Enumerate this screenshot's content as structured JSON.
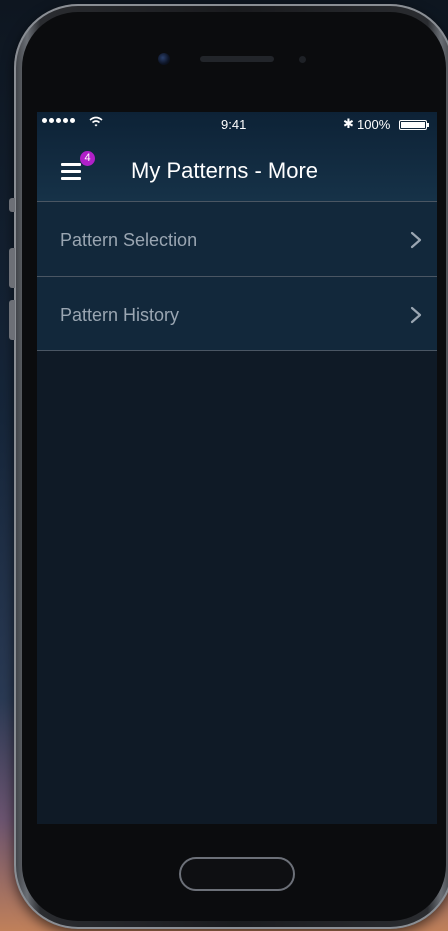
{
  "status_bar": {
    "time": "9:41",
    "battery": "100%",
    "bluetooth_glyph": "✱"
  },
  "header": {
    "title": "My Patterns - More",
    "menu_badge": "4"
  },
  "menu_items": [
    {
      "label": "Pattern Selection"
    },
    {
      "label": "Pattern History"
    }
  ],
  "colors": {
    "badge": "#b020c8",
    "header": "#163248",
    "list_background": "#12283b",
    "screen_background": "#0f1a26"
  }
}
